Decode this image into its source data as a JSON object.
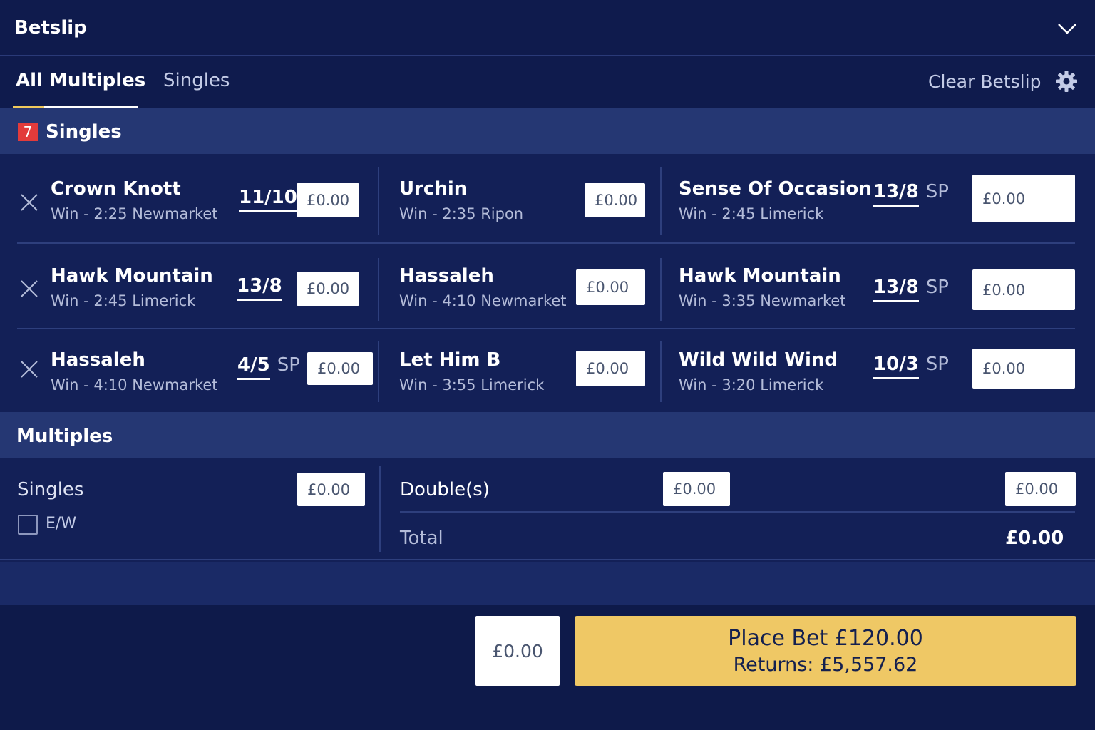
{
  "header": {
    "title": "Betslip",
    "collapse_icon": "chevron-down-icon"
  },
  "tabs": {
    "active": "All Multiples",
    "inactive": "Singles",
    "clear_label": "Clear Betslip",
    "settings_icon": "gear-icon",
    "accent_color": "#f0c95c"
  },
  "singles_section": {
    "count": "7",
    "title": "Singles"
  },
  "selections": [
    {
      "name": "Crown Knott",
      "market": "Win - 2:25 Newmarket",
      "odds": "11/10",
      "sp": "",
      "stake": "£0.00"
    },
    {
      "name": "Urchin",
      "market": "Win - 2:35 Ripon",
      "odds": "",
      "sp": "",
      "stake": "£0.00"
    },
    {
      "name": "Sense Of Occasion",
      "market": "Win - 2:45 Limerick",
      "odds": "13/8",
      "sp": "SP",
      "stake": "£0.00"
    },
    {
      "name": "Hawk Mountain",
      "market": "Win - 2:45 Limerick",
      "odds": "13/8",
      "sp": "",
      "stake": "£0.00"
    },
    {
      "name": "Hassaleh",
      "market": "Win - 4:10 Newmarket",
      "odds": "",
      "sp": "",
      "stake": "£0.00"
    },
    {
      "name": "Hawk Mountain",
      "market": "Win - 3:35 Newmarket",
      "odds": "13/8",
      "sp": "SP",
      "stake": "£0.00"
    },
    {
      "name": "Hassaleh",
      "market": "Win - 4:10 Newmarket",
      "odds": "4/5",
      "sp": "SP",
      "stake": "£0.00"
    },
    {
      "name": "Let Him B",
      "market": "Win - 3:55 Limerick",
      "odds": "",
      "sp": "",
      "stake": "£0.00"
    },
    {
      "name": "Wild Wild Wind",
      "market": "Win - 3:20 Limerick",
      "odds": "10/3",
      "sp": "SP",
      "stake": "£0.00"
    }
  ],
  "multiples_section": {
    "title": "Multiples"
  },
  "multiples": {
    "singles_label": "Singles",
    "singles_stake": "£0.00",
    "ew_label": "E/W",
    "ew_checked": false,
    "doubles_label": "Double(s)",
    "doubles_stake": "£0.00",
    "doubles_stake_2": "£0.00",
    "total_label": "Total",
    "total_value": "£0.00"
  },
  "footer": {
    "stake": "£0.00",
    "place_bet_label": "Place Bet £120.00",
    "returns_label": "Returns: £5,557.62"
  },
  "colors": {
    "background": "#132057",
    "header_bg": "#0f1b4d",
    "section_bg": "#253773",
    "badge": "#e23b3b",
    "cta": "#efc865"
  }
}
